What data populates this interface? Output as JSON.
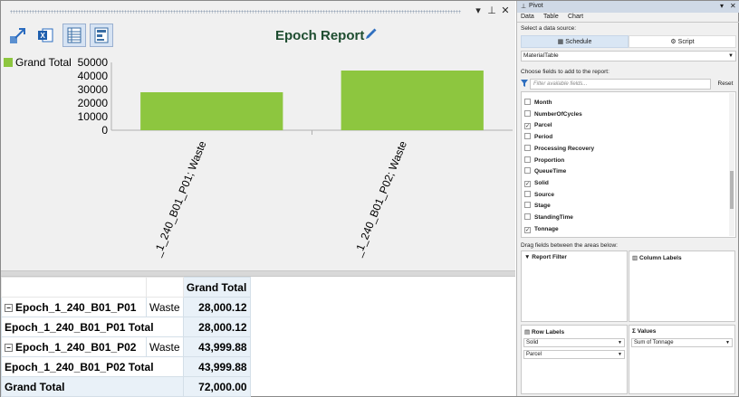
{
  "report": {
    "title": "Epoch Report"
  },
  "chart_data": {
    "type": "bar",
    "title": "",
    "categories": [
      "_1_240_B01_P01; Waste",
      "_1_240_B01_P02; Waste"
    ],
    "series": [
      {
        "name": "Grand Total",
        "values": [
          28000.12,
          43999.88
        ],
        "color": "#8dc63f"
      }
    ],
    "ylim": [
      0,
      50000
    ],
    "yticks": [
      "50000",
      "40000",
      "30000",
      "20000",
      "10000",
      "0"
    ],
    "legend": "top-left",
    "grid": false
  },
  "pivot": {
    "header": "Grand Total",
    "rows": [
      {
        "label": "Epoch_1_240_B01_P01",
        "sub": "Waste",
        "value": "28,000.12",
        "type": "group"
      },
      {
        "label": "Epoch_1_240_B01_P01 Total",
        "value": "28,000.12",
        "type": "total"
      },
      {
        "label": "Epoch_1_240_B01_P02",
        "sub": "Waste",
        "value": "43,999.88",
        "type": "group"
      },
      {
        "label": "Epoch_1_240_B01_P02 Total",
        "value": "43,999.88",
        "type": "total"
      }
    ],
    "grand_total_label": "Grand Total",
    "grand_total_value": "72,000.00"
  },
  "panel": {
    "title": "Pivot",
    "tabs": [
      "Data",
      "Table",
      "Chart"
    ],
    "select_source_label": "Select a data source:",
    "source_schedule": "Schedule",
    "source_script": "Script",
    "source_table": "MaterialTable",
    "choose_fields_label": "Choose fields to add to the report:",
    "filter_placeholder": "Filter available fields...",
    "reset_label": "Reset",
    "fields": [
      {
        "name": "Month",
        "checked": false
      },
      {
        "name": "NumberOfCycles",
        "checked": false
      },
      {
        "name": "Parcel",
        "checked": true
      },
      {
        "name": "Period",
        "checked": false
      },
      {
        "name": "Processing Recovery",
        "checked": false
      },
      {
        "name": "Proportion",
        "checked": false
      },
      {
        "name": "QueueTime",
        "checked": false
      },
      {
        "name": "Solid",
        "checked": true
      },
      {
        "name": "Source",
        "checked": false
      },
      {
        "name": "Stage",
        "checked": false
      },
      {
        "name": "StandingTime",
        "checked": false
      },
      {
        "name": "Tonnage",
        "checked": true
      }
    ],
    "drag_label": "Drag fields between the areas below:",
    "report_filter_label": "Report Filter",
    "column_labels_label": "Column Labels",
    "row_labels_label": "Row Labels",
    "values_label": "Values",
    "row_label_items": [
      "Solid",
      "Parcel"
    ],
    "value_items": [
      "Sum of Tonnage"
    ]
  }
}
